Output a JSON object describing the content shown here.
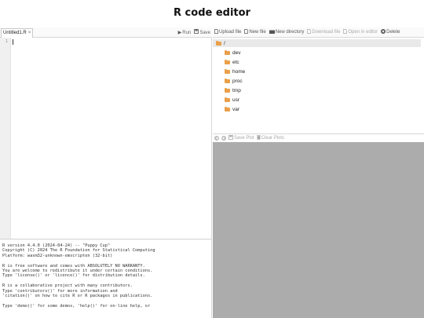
{
  "page": {
    "title": "R code editor"
  },
  "editor": {
    "tab_label": "Untitled1.R",
    "tab_close": "×",
    "run_label": "Run",
    "save_label": "Save",
    "line_numbers": [
      "1"
    ]
  },
  "files_toolbar": {
    "upload_label": "Upload file",
    "new_file_label": "New file",
    "new_directory_label": "New directory",
    "download_label": "Download file",
    "open_label": "Open in editor",
    "delete_label": "Delete"
  },
  "file_tree": {
    "root": "/",
    "items": [
      "dev",
      "etc",
      "home",
      "proc",
      "tmp",
      "usr",
      "var"
    ]
  },
  "plot_toolbar": {
    "save_plot_label": "Save Plot",
    "clear_plots_label": "Clear Plots"
  },
  "console": {
    "lines": [
      "R version 4.4.0 (2024-04-24) -- \"Puppy Cup\"",
      "Copyright (C) 2024 The R Foundation for Statistical Computing",
      "Platform: wasm32-unknown-emscripten (32-bit)",
      "",
      "R is free software and comes with ABSOLUTELY NO WARRANTY.",
      "You are welcome to redistribute it under certain conditions.",
      "Type 'license()' or 'licence()' for distribution details.",
      "",
      "R is a collaborative project with many contributors.",
      "Type 'contributors()' for more information and",
      "'citation()' on how to cite R or R packages in publications.",
      "",
      "Type 'demo()' for some demos, 'help()' for on-line help, or"
    ]
  }
}
